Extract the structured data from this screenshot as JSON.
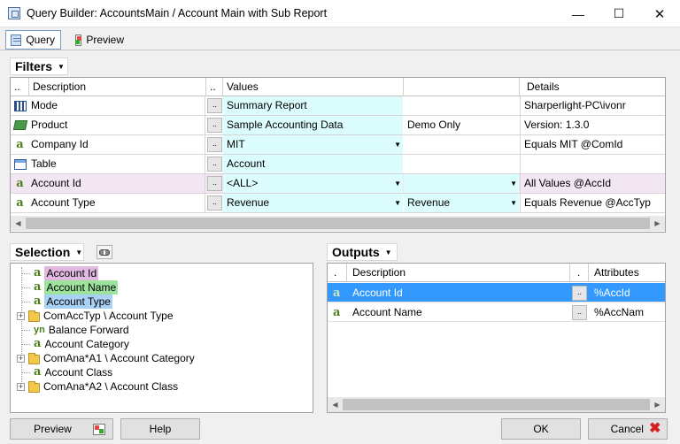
{
  "window": {
    "title": "Query Builder:  AccountsMain / Account Main with Sub Report",
    "min_glyph": "—",
    "max_glyph": "☐",
    "close_glyph": "✕"
  },
  "tabs": [
    {
      "label": "Query",
      "icon": "query-icon",
      "active": true
    },
    {
      "label": "Preview",
      "icon": "preview-icon",
      "active": false
    }
  ],
  "filters": {
    "header": "Filters",
    "columns": {
      "marker": "..",
      "description": "Description",
      "btn": "..",
      "values": "Values",
      "details": "Details"
    },
    "rows": [
      {
        "icon": "mode-icon",
        "description": "Mode",
        "btn": "..",
        "value": "Summary Report",
        "extra": "",
        "details": "Sharperlight-PC\\ivonr"
      },
      {
        "icon": "product-icon",
        "description": "Product",
        "btn": "..",
        "value": "Sample Accounting Data",
        "extra": "Demo Only",
        "details": "Version: 1.3.0"
      },
      {
        "icon": "field-a-icon",
        "glyph": "a",
        "description": "Company Id",
        "btn": "..",
        "value": "MIT",
        "extra": "",
        "details": "Equals MIT @ComId"
      },
      {
        "icon": "table-icon",
        "description": "Table",
        "btn": "..",
        "value": "Account",
        "extra": "",
        "details": ""
      },
      {
        "icon": "field-a-icon",
        "glyph": "a",
        "description": "Account Id",
        "btn": "..",
        "value": "<ALL>",
        "extra": "",
        "details": "All Values @AccId"
      },
      {
        "icon": "field-a-icon",
        "glyph": "a",
        "description": "Account Type",
        "btn": "..",
        "value": "Revenue",
        "extra": "Revenue",
        "details": "Equals Revenue @AccTyp"
      }
    ]
  },
  "selection": {
    "header": "Selection",
    "items": [
      {
        "glyph": "a",
        "label": "Account Id"
      },
      {
        "glyph": "a",
        "label": "Account Name"
      },
      {
        "glyph": "a",
        "label": "Account Type"
      },
      {
        "label": "ComAccTyp \\ Account Type"
      },
      {
        "glyph": "yn",
        "label": "Balance Forward"
      },
      {
        "glyph": "a",
        "label": "Account Category"
      },
      {
        "label": "ComAna*A1 \\ Account Category"
      },
      {
        "glyph": "a",
        "label": "Account Class"
      },
      {
        "label": "ComAna*A2 \\ Account Class"
      }
    ],
    "expander_glyph": "+"
  },
  "outputs": {
    "header": "Outputs",
    "columns": {
      "marker": ".",
      "description": "Description",
      "btn": ".",
      "attributes": "Attributes"
    },
    "rows": [
      {
        "glyph": "a",
        "description": "Account Id",
        "btn": "..",
        "attributes": "%AccId"
      },
      {
        "glyph": "a",
        "description": "Account Name",
        "btn": "..",
        "attributes": "%AccNam"
      }
    ]
  },
  "buttons": {
    "preview": "Preview",
    "help": "Help",
    "ok": "OK",
    "cancel": "Cancel"
  },
  "colors": {
    "value_cell": "#dcfdfd",
    "highlight_purple": "#e0b8e0",
    "highlight_green": "#9de29d",
    "highlight_blue": "#a9d0f5",
    "selected_row": "#3399ff"
  }
}
